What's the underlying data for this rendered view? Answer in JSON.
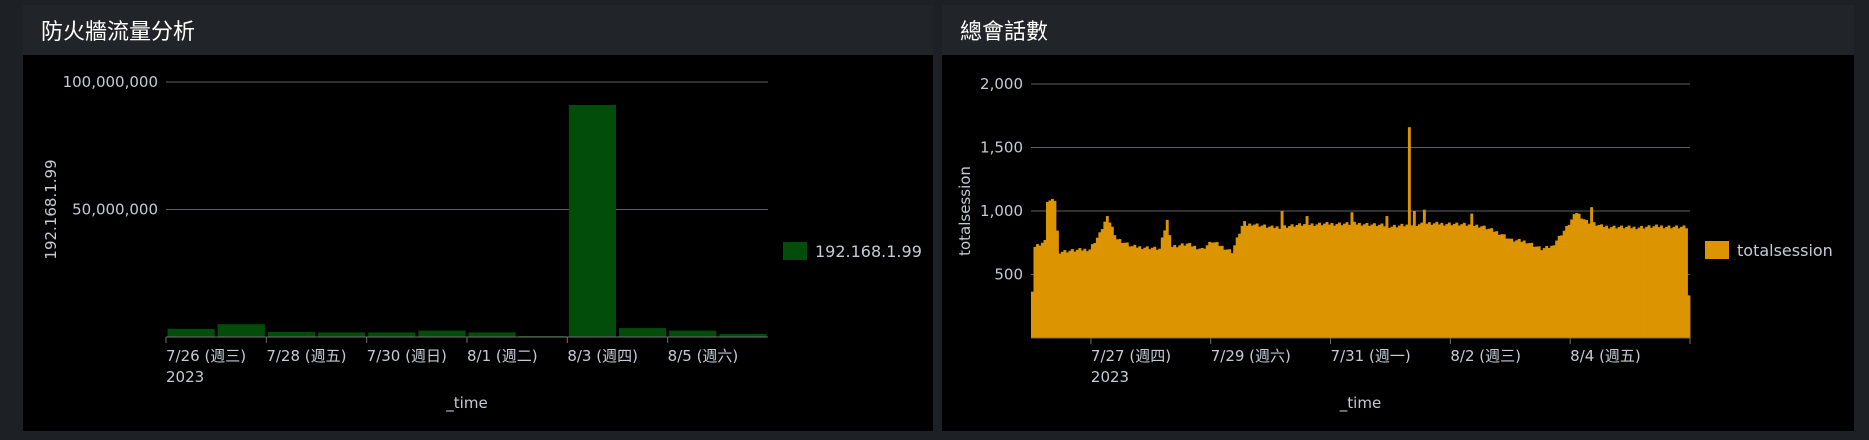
{
  "panels": [
    {
      "title": "防火牆流量分析"
    },
    {
      "title": "總會話數"
    }
  ],
  "chart_data": [
    {
      "type": "bar",
      "title": "防火牆流量分析",
      "xlabel": "_time",
      "ylabel": "192.168.1.99",
      "ylim": [
        0,
        100000000
      ],
      "y_ticks": [
        {
          "value": 50000000,
          "label": "50,000,000"
        },
        {
          "value": 100000000,
          "label": "100,000,000"
        }
      ],
      "categories": [
        "2023-07-26",
        "2023-07-27",
        "2023-07-28",
        "2023-07-29",
        "2023-07-30",
        "2023-07-31",
        "2023-08-01",
        "2023-08-02",
        "2023-08-03",
        "2023-08-04",
        "2023-08-05",
        "2023-08-06"
      ],
      "x_tick_labels": [
        {
          "at": 0,
          "label": "7/26 (週三)",
          "sub": "2023"
        },
        {
          "at": 2,
          "label": "7/28 (週五)"
        },
        {
          "at": 4,
          "label": "7/30 (週日)"
        },
        {
          "at": 6,
          "label": "8/1 (週二)"
        },
        {
          "at": 8,
          "label": "8/3 (週四)"
        },
        {
          "at": 10,
          "label": "8/5 (週六)"
        }
      ],
      "series": [
        {
          "name": "192.168.1.99",
          "color": "#024d0a",
          "values": [
            3200000,
            5000000,
            2000000,
            1800000,
            1800000,
            2500000,
            1800000,
            400000,
            91000000,
            3500000,
            2500000,
            1200000
          ]
        }
      ],
      "legend": "right",
      "grid": true
    },
    {
      "type": "bar",
      "title": "總會話數",
      "xlabel": "_time",
      "ylabel": "totalsession",
      "ylim": [
        0,
        2000
      ],
      "y_ticks": [
        {
          "value": 500,
          "label": "500"
        },
        {
          "value": 1000,
          "label": "1,000"
        },
        {
          "value": 1500,
          "label": "1,500"
        },
        {
          "value": 2000,
          "label": "2,000"
        }
      ],
      "x_range": [
        "2023-07-26T00:00",
        "2023-08-06T00:00"
      ],
      "bucket": "1h",
      "x_tick_labels": [
        {
          "at": "2023-07-27T00:00",
          "label": "7/27 (週四)",
          "sub": "2023"
        },
        {
          "at": "2023-07-29T00:00",
          "label": "7/29 (週六)"
        },
        {
          "at": "2023-07-31T00:00",
          "label": "7/31 (週一)"
        },
        {
          "at": "2023-08-02T00:00",
          "label": "8/2 (週三)"
        },
        {
          "at": "2023-08-04T00:00",
          "label": "8/4 (週五)"
        }
      ],
      "extra_x_ticks": [
        "2023-08-06T00:00"
      ],
      "series": [
        {
          "name": "totalsession",
          "color": "#dc9500",
          "keyframes": [
            [
              "2023-07-26T00:00",
              380
            ],
            [
              "2023-07-26T01:00",
              720
            ],
            [
              "2023-07-26T05:00",
              760
            ],
            [
              "2023-07-26T06:00",
              1080
            ],
            [
              "2023-07-26T09:00",
              1080
            ],
            [
              "2023-07-26T10:00",
              840
            ],
            [
              "2023-07-26T11:00",
              680
            ],
            [
              "2023-07-26T23:00",
              700
            ],
            [
              "2023-07-27T03:00",
              820
            ],
            [
              "2023-07-27T06:00",
              960
            ],
            [
              "2023-07-27T10:00",
              780
            ],
            [
              "2023-07-27T16:00",
              720
            ],
            [
              "2023-07-28T00:00",
              710
            ],
            [
              "2023-07-28T03:00",
              700
            ],
            [
              "2023-07-28T06:00",
              930
            ],
            [
              "2023-07-28T08:00",
              720
            ],
            [
              "2023-07-28T14:00",
              740
            ],
            [
              "2023-07-28T20:00",
              700
            ],
            [
              "2023-07-29T00:00",
              760
            ],
            [
              "2023-07-29T04:00",
              720
            ],
            [
              "2023-07-29T08:00",
              680
            ],
            [
              "2023-07-29T12:00",
              880
            ],
            [
              "2023-07-29T16:00",
              900
            ],
            [
              "2023-07-30T00:00",
              870
            ],
            [
              "2023-07-30T12:00",
              890
            ],
            [
              "2023-07-31T00:00",
              900
            ],
            [
              "2023-07-31T12:00",
              900
            ],
            [
              "2023-08-01T00:00",
              880
            ],
            [
              "2023-08-01T12:00",
              900
            ],
            [
              "2023-08-02T00:00",
              900
            ],
            [
              "2023-08-02T12:00",
              880
            ],
            [
              "2023-08-02T20:00",
              820
            ],
            [
              "2023-08-03T00:00",
              770
            ],
            [
              "2023-08-03T06:00",
              760
            ],
            [
              "2023-08-03T12:00",
              700
            ],
            [
              "2023-08-03T16:00",
              720
            ],
            [
              "2023-08-03T22:00",
              870
            ],
            [
              "2023-08-04T02:00",
              990
            ],
            [
              "2023-08-04T06:00",
              920
            ],
            [
              "2023-08-04T12:00",
              880
            ],
            [
              "2023-08-05T00:00",
              870
            ],
            [
              "2023-08-05T12:00",
              880
            ],
            [
              "2023-08-05T22:00",
              870
            ],
            [
              "2023-08-05T23:00",
              330
            ]
          ],
          "spikes": [
            [
              "2023-07-26T09:00",
              1080
            ],
            [
              "2023-07-27T06:00",
              960
            ],
            [
              "2023-07-28T06:00",
              930
            ],
            [
              "2023-07-29T13:00",
              920
            ],
            [
              "2023-07-30T04:00",
              1000
            ],
            [
              "2023-07-30T14:00",
              960
            ],
            [
              "2023-07-31T08:00",
              990
            ],
            [
              "2023-07-31T22:00",
              960
            ],
            [
              "2023-08-01T07:00",
              1660
            ],
            [
              "2023-08-01T09:00",
              1000
            ],
            [
              "2023-08-01T13:00",
              1010
            ],
            [
              "2023-08-02T08:00",
              980
            ],
            [
              "2023-08-04T08:00",
              1030
            ]
          ]
        }
      ],
      "legend": "right",
      "grid": true
    }
  ]
}
